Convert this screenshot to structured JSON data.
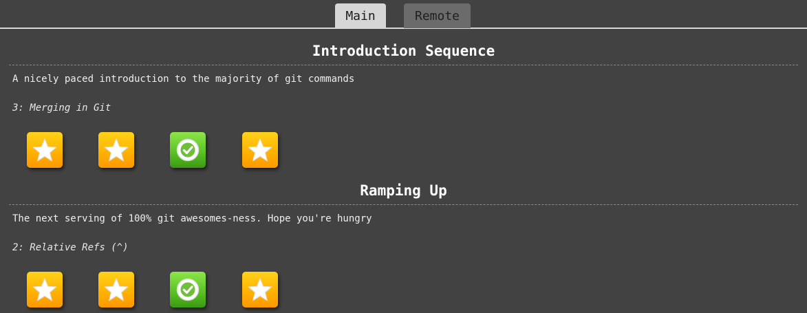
{
  "tabs": [
    {
      "label": "Main",
      "active": true
    },
    {
      "label": "Remote",
      "active": false
    }
  ],
  "sections": [
    {
      "title": "Introduction Sequence",
      "description": "A nicely paced introduction to the majority of git commands",
      "current_level": "3: Merging in Git",
      "levels": [
        {
          "icon": "star-icon",
          "status": "available"
        },
        {
          "icon": "star-icon",
          "status": "available"
        },
        {
          "icon": "checkmark-icon",
          "status": "completed"
        },
        {
          "icon": "star-icon",
          "status": "available"
        }
      ]
    },
    {
      "title": "Ramping Up",
      "description": "The next serving of 100% git awesomes-ness. Hope you're hungry",
      "current_level": "2: Relative Refs (^)",
      "levels": [
        {
          "icon": "star-icon",
          "status": "available"
        },
        {
          "icon": "star-icon",
          "status": "available"
        },
        {
          "icon": "checkmark-icon",
          "status": "completed"
        },
        {
          "icon": "star-icon",
          "status": "available"
        }
      ]
    }
  ],
  "colors": {
    "background": "#424242",
    "star_button": "#ffb300",
    "completed_button": "#5cc324",
    "tab_active": "#d6d6d6",
    "tab_inactive": "#6b6b6b"
  }
}
